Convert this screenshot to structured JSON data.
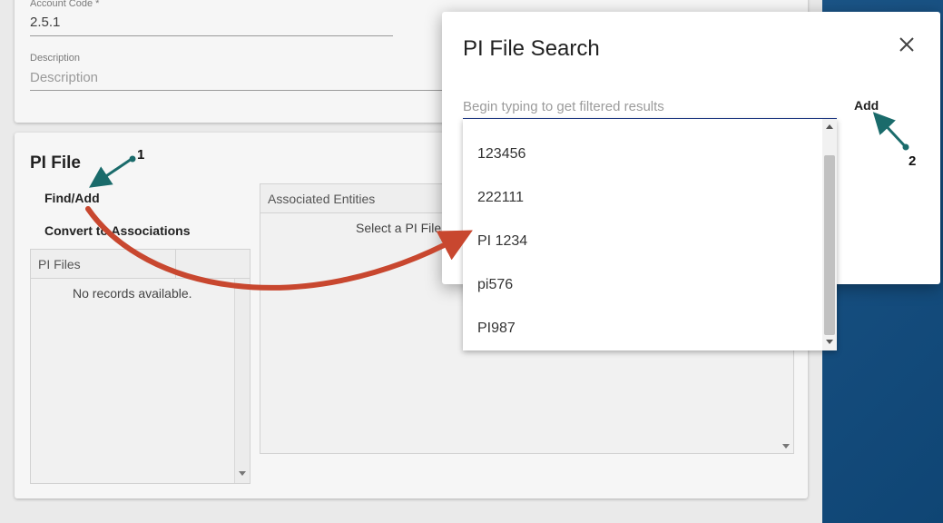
{
  "form": {
    "account_code_label": "Account Code *",
    "account_code_value": "2.5.1",
    "description_label": "Description",
    "description_placeholder": "Description"
  },
  "pi_section": {
    "title": "PI File",
    "find_add_label": "Find/Add",
    "convert_label": "Convert to Associations",
    "pi_files_grid": {
      "header": "PI Files",
      "empty_message": "No records available."
    },
    "associated_grid": {
      "header": "Associated Entities",
      "message": "Select a PI File"
    }
  },
  "modal": {
    "title": "PI File Search",
    "search_placeholder": "Begin typing to get filtered results",
    "search_value": "",
    "add_label": "Add",
    "results": [
      "123456",
      "222111",
      "PI 1234",
      "pi576",
      "PI987"
    ]
  },
  "annotations": {
    "step1": "1",
    "step2": "2",
    "teal_color": "#1a6b6b",
    "red_color": "#c8472f"
  },
  "icons": {
    "close": "close-icon"
  }
}
